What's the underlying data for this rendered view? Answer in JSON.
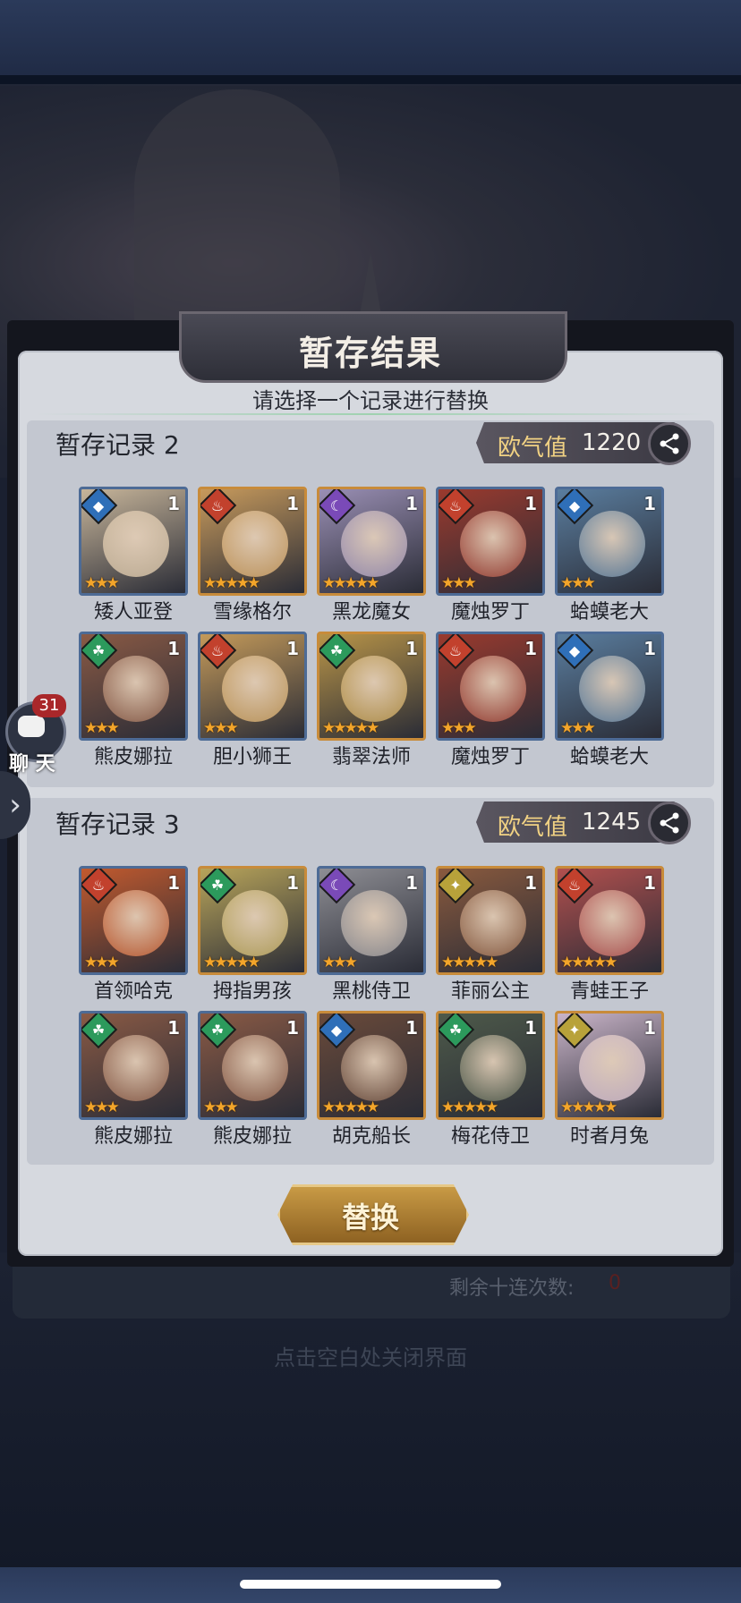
{
  "dialog": {
    "title": "暂存结果",
    "subtitle": "请选择一个记录进行替换",
    "swap_label": "替换",
    "remaining_label": "剩余十连次数:",
    "remaining_value": "0",
    "close_hint": "点击空白处关闭界面"
  },
  "luck_label": "欧气值",
  "records": [
    {
      "title": "暂存记录 2",
      "luck": "1220",
      "heroes": [
        {
          "name": "矮人亚登",
          "element": "water-icon",
          "count": "1",
          "stars": 3,
          "tint": "#c7b59a"
        },
        {
          "name": "雪缘格尔",
          "element": "fire-icon",
          "count": "1",
          "stars": 5,
          "tint": "#c79a5c"
        },
        {
          "name": "黑龙魔女",
          "element": "moon-icon",
          "count": "1",
          "stars": 5,
          "tint": "#9a8fb4"
        },
        {
          "name": "魔烛罗丁",
          "element": "fire-icon",
          "count": "1",
          "stars": 3,
          "tint": "#9a3a2e"
        },
        {
          "name": "蛤蟆老大",
          "element": "water-icon",
          "count": "1",
          "stars": 3,
          "tint": "#5a7d9e"
        },
        {
          "name": "熊皮娜拉",
          "element": "wind-icon",
          "count": "1",
          "stars": 3,
          "tint": "#8a5a45"
        },
        {
          "name": "胆小狮王",
          "element": "fire-icon",
          "count": "1",
          "stars": 3,
          "tint": "#c49a5a"
        },
        {
          "name": "翡翠法师",
          "element": "wind-icon",
          "count": "1",
          "stars": 5,
          "tint": "#b89448"
        },
        {
          "name": "魔烛罗丁",
          "element": "fire-icon",
          "count": "1",
          "stars": 3,
          "tint": "#9a3a2e"
        },
        {
          "name": "蛤蟆老大",
          "element": "water-icon",
          "count": "1",
          "stars": 3,
          "tint": "#5a7d9e"
        }
      ]
    },
    {
      "title": "暂存记录 3",
      "luck": "1245",
      "heroes": [
        {
          "name": "首领哈克",
          "element": "fire-icon",
          "count": "1",
          "stars": 3,
          "tint": "#c25a2e"
        },
        {
          "name": "拇指男孩",
          "element": "wind-icon",
          "count": "1",
          "stars": 5,
          "tint": "#b8a45a"
        },
        {
          "name": "黑桃侍卫",
          "element": "moon-icon",
          "count": "1",
          "stars": 3,
          "tint": "#8e8e94"
        },
        {
          "name": "菲丽公主",
          "element": "light-icon",
          "count": "1",
          "stars": 5,
          "tint": "#8a5a3e"
        },
        {
          "name": "青蛙王子",
          "element": "fire-icon",
          "count": "1",
          "stars": 5,
          "tint": "#b2504e"
        },
        {
          "name": "熊皮娜拉",
          "element": "wind-icon",
          "count": "1",
          "stars": 3,
          "tint": "#8a5a45"
        },
        {
          "name": "熊皮娜拉",
          "element": "wind-icon",
          "count": "1",
          "stars": 3,
          "tint": "#8a5a45"
        },
        {
          "name": "胡克船长",
          "element": "water-icon",
          "count": "1",
          "stars": 5,
          "tint": "#6a4a3a"
        },
        {
          "name": "梅花侍卫",
          "element": "wind-icon",
          "count": "1",
          "stars": 5,
          "tint": "#4e5a4a"
        },
        {
          "name": "时者月兔",
          "element": "light-icon",
          "count": "1",
          "stars": 5,
          "tint": "#c9b4c8"
        }
      ]
    }
  ],
  "chat": {
    "badge": "31",
    "label": "聊 天"
  },
  "colors": {
    "fire": "#c2412d",
    "water": "#2f6fb8",
    "wind": "#2c9a5c",
    "moon": "#7a4ab8",
    "light": "#b8a23a",
    "star": "#f3a52a"
  }
}
